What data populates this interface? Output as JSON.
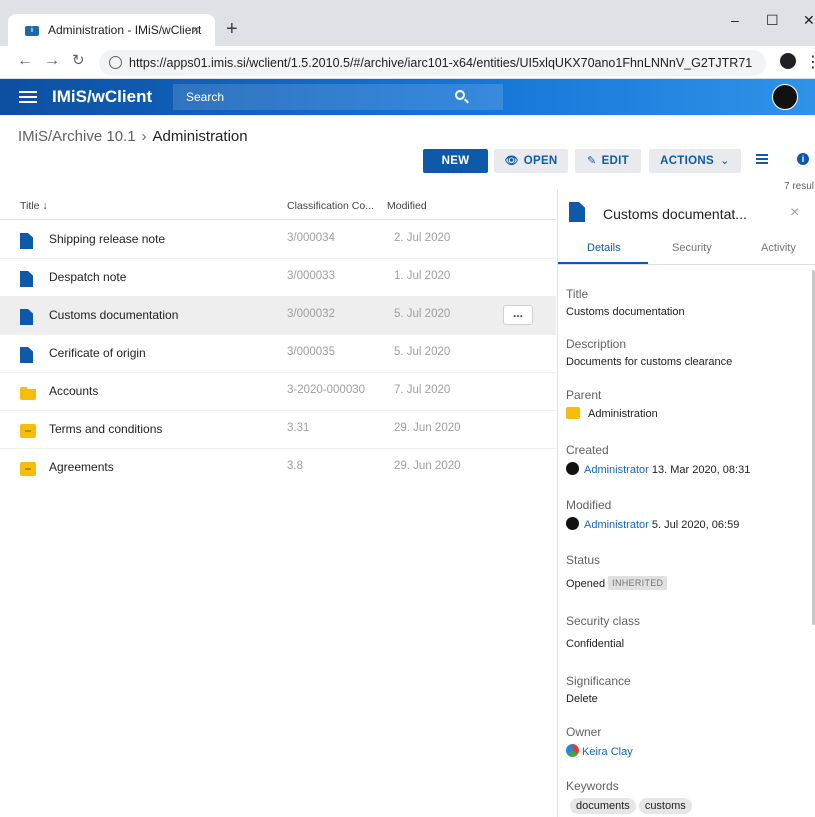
{
  "browser": {
    "tab_title": "Administration - IMiS/wClient",
    "tab_close": "×",
    "new_tab": "+",
    "url": "https://apps01.imis.si/wclient/1.5.2010.5/#/archive/iarc101-x64/entities/UI5xlqUKX70ano1FhnLNNnV_G2TJTR71"
  },
  "appbar": {
    "title": "IMiS/wClient",
    "search_label": "Search"
  },
  "breadcrumb": {
    "root": "IMiS/Archive 10.1",
    "separator": "›",
    "current": "Administration"
  },
  "toolbar": {
    "new_label": "NEW",
    "open_label": "OPEN",
    "edit_label": "EDIT",
    "actions_label": "ACTIONS",
    "results": "7 resul"
  },
  "table": {
    "columns": {
      "title": "Title ↓",
      "classification": "Classification Co...",
      "modified": "Modified"
    },
    "rows": [
      {
        "type": "document",
        "title": "Shipping release note",
        "classification": "3/000034",
        "modified": "2. Jul 2020"
      },
      {
        "type": "document",
        "title": "Despatch note",
        "classification": "3/000033",
        "modified": "1. Jul 2020"
      },
      {
        "type": "document",
        "title": "Customs documentation",
        "classification": "3/000032",
        "modified": "5. Jul 2020",
        "selected": true,
        "more": "..."
      },
      {
        "type": "document",
        "title": "Cerificate of origin",
        "classification": "3/000035",
        "modified": "5. Jul 2020"
      },
      {
        "type": "folder",
        "title": "Accounts",
        "classification": "3-2020-000030",
        "modified": "7. Jul 2020"
      },
      {
        "type": "box",
        "title": "Terms and conditions",
        "classification": "3.31",
        "modified": "29. Jun 2020"
      },
      {
        "type": "box",
        "title": "Agreements",
        "classification": "3.8",
        "modified": "29. Jun 2020"
      }
    ]
  },
  "panel": {
    "title": "Customs documentat...",
    "close": "×",
    "tabs": [
      "Details",
      "Security",
      "Activity"
    ],
    "active_tab": "Details",
    "fields": {
      "title_label": "Title",
      "title_value": "Customs documentation",
      "description_label": "Description",
      "description_value": "Documents for customs clearance",
      "parent_label": "Parent",
      "parent_value": "Administration",
      "created_label": "Created",
      "created_user": "Administrator",
      "created_date": "13. Mar 2020, 08:31",
      "modified_label": "Modified",
      "modified_user": "Administrator",
      "modified_date": "5. Jul 2020, 06:59",
      "status_label": "Status",
      "status_value": "Opened",
      "status_badge": "INHERITED",
      "security_label": "Security class",
      "security_value": "Confidential",
      "significance_label": "Significance",
      "significance_value": "Delete",
      "owner_label": "Owner",
      "owner_value": "Keira Clay",
      "keywords_label": "Keywords",
      "keywords": [
        "documents",
        "customs"
      ]
    }
  },
  "colors": {
    "primary": "#0f5aa8",
    "folder": "#f6be0a",
    "appbar_start": "#0d4fa0",
    "appbar_end": "#2e93e8"
  }
}
